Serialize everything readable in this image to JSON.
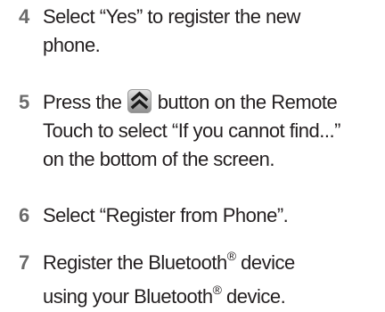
{
  "steps": [
    {
      "number": "4",
      "lines": [
        "Select “Yes” to register the new",
        "phone."
      ]
    },
    {
      "number": "5",
      "line1_before": "Press the",
      "line1_after": "button on the Remote",
      "icon": "double-chevron-up-icon",
      "lines_rest": [
        "Touch to select “If you cannot find...”",
        "on the bottom of the screen."
      ]
    },
    {
      "number": "6",
      "lines": [
        "Select “Register from Phone”."
      ]
    },
    {
      "number": "7",
      "line1_before": "Register the Bluetooth",
      "line2_before": "using your Bluetooth",
      "registered_mark": "®",
      "line1_after": " device",
      "line2_after": " device."
    }
  ],
  "colors": {
    "text": "#231f20",
    "step_number": "#6b6b6b",
    "icon_bg_light": "#d9d9d9",
    "icon_bg_dark": "#8c8c8c",
    "icon_chevron": "#1a1a1a"
  }
}
